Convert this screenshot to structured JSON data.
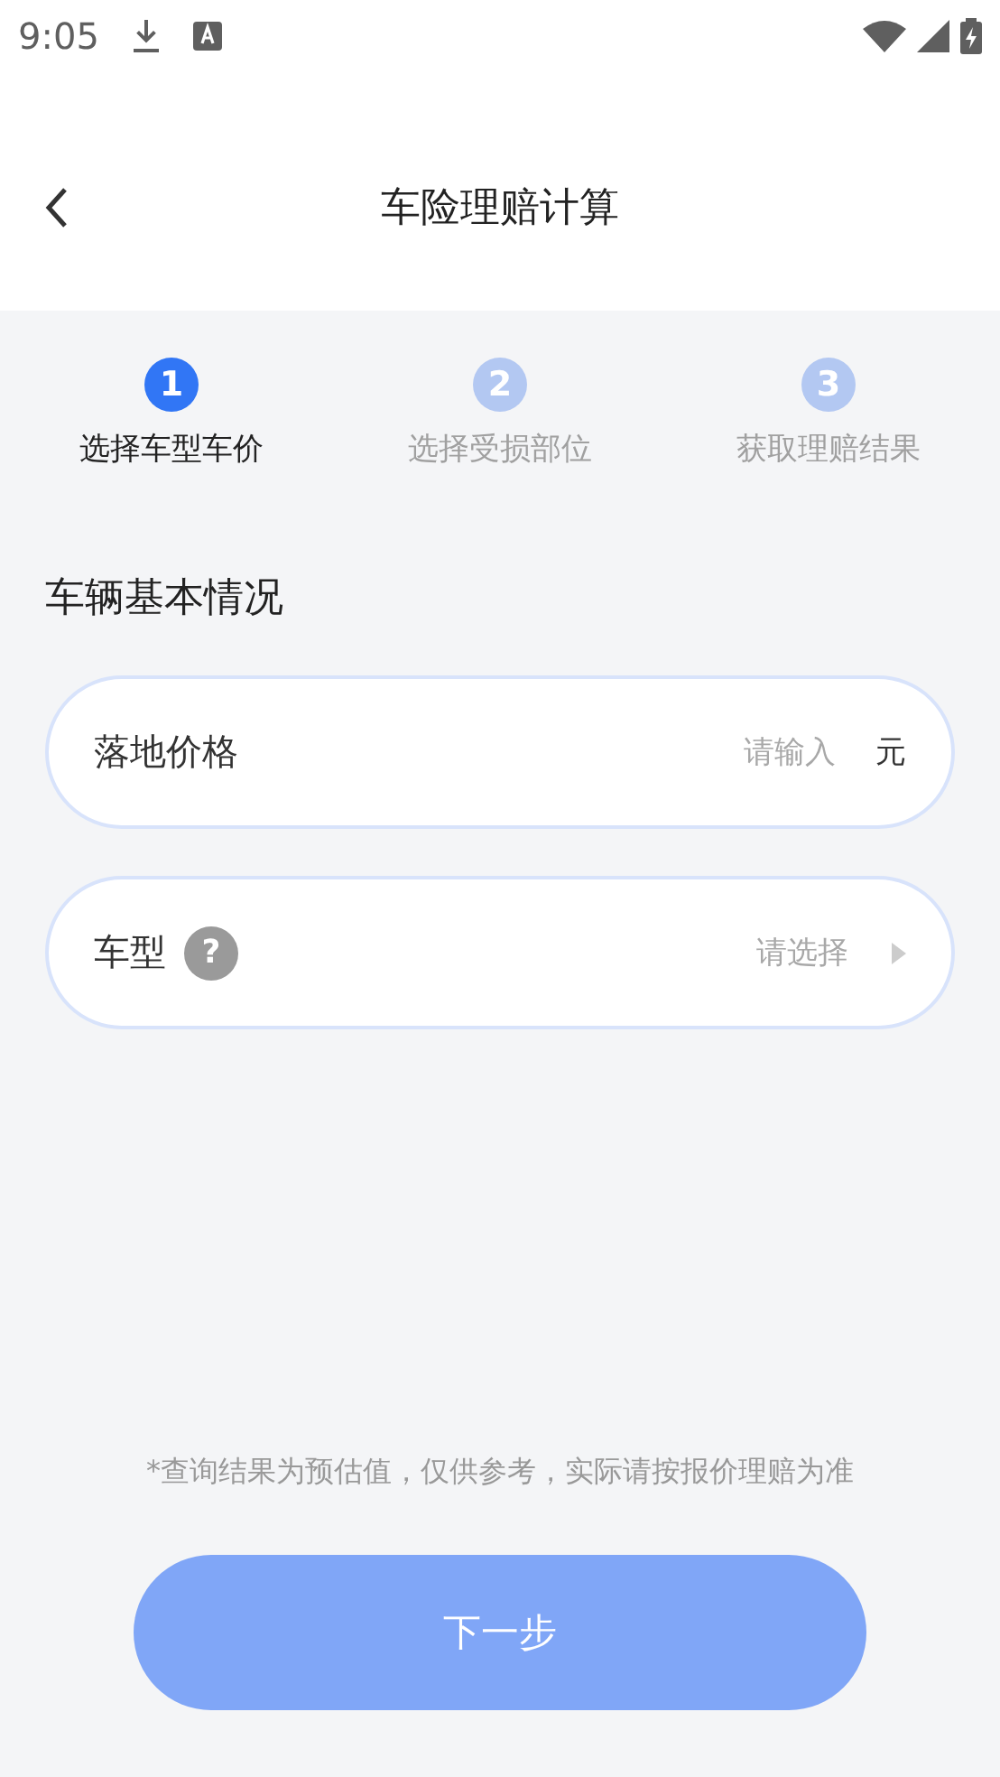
{
  "status_bar": {
    "time": "9:05"
  },
  "header": {
    "title": "车险理赔计算"
  },
  "steps": [
    {
      "number": "1",
      "label": "选择车型车价",
      "selected": true
    },
    {
      "number": "2",
      "label": "选择受损部位",
      "selected": false
    },
    {
      "number": "3",
      "label": "获取理赔结果",
      "selected": false
    }
  ],
  "section": {
    "title": "车辆基本情况"
  },
  "fields": [
    {
      "kind": "input",
      "label": "落地价格",
      "placeholder": "请输入",
      "unit": "元"
    },
    {
      "kind": "select",
      "label": "车型",
      "help": "?",
      "placeholder": "请选择"
    }
  ],
  "disclaimer": "*查询结果为预估值，仅供参考，实际请按报价理赔为准",
  "next_button": {
    "label": "下一步",
    "disabled": true
  }
}
